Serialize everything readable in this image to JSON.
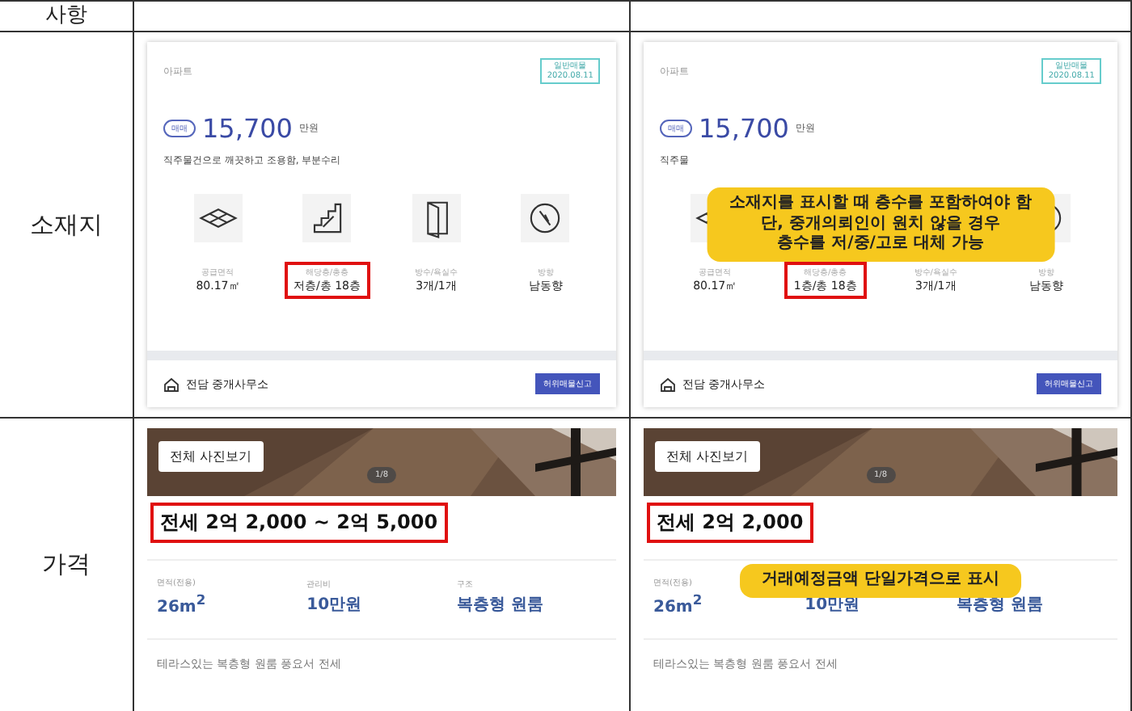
{
  "header": {
    "label": "사항"
  },
  "location": {
    "label": "소재지",
    "panels": [
      {
        "type": "아파트",
        "badge": [
          "일반매물",
          "2020.08.11"
        ],
        "deal": "매매",
        "price": "15,700",
        "unit": "만원",
        "desc": "직주물건으로 깨끗하고 조용함, 부분수리",
        "features": [
          {
            "kind": "area",
            "label": "공급면적",
            "value": "80.17㎡",
            "highlighted": false
          },
          {
            "kind": "stairs",
            "label": "해당층/총층",
            "value": "저층/총 18층",
            "highlighted": true
          },
          {
            "kind": "door",
            "label": "방수/욕실수",
            "value": "3개/1개",
            "highlighted": false
          },
          {
            "kind": "compass",
            "label": "방향",
            "value": "남동향",
            "highlighted": false
          }
        ],
        "agency": "전담 중개사무소",
        "report": "허위매물신고"
      },
      {
        "type": "아파트",
        "badge": [
          "일반매물",
          "2020.08.11"
        ],
        "deal": "매매",
        "price": "15,700",
        "unit": "만원",
        "desc": "직주물",
        "features": [
          {
            "kind": "area",
            "label": "공급면적",
            "value": "80.17㎡",
            "highlighted": false
          },
          {
            "label": "해당층/총층",
            "value": "1층/총 18층",
            "highlighted": true
          },
          {
            "label": "방수/욕실수",
            "value": "3개/1개",
            "highlighted": false
          },
          {
            "kind": "compass",
            "label": "방향",
            "value": "남동향",
            "highlighted": false
          }
        ],
        "agency": "전담 중개사무소",
        "report": "허위매물신고",
        "callout": [
          "소재지를 표시할 때 층수를 포함하여야 함",
          "단, 중개의뢰인이 원치 않을 경우",
          "층수를 저/중/고로 대체 가능"
        ]
      }
    ]
  },
  "price": {
    "label": "가격",
    "panels": [
      {
        "photo_button": "전체 사진보기",
        "counter": "1/8",
        "price": "전세 2억 2,000 ~ 2억 5,000",
        "price_highlighted": true,
        "specs": [
          {
            "label": "면적(전용)",
            "value": "26m$^{2}$"
          },
          {
            "label": "관리비",
            "value": "10만원"
          },
          {
            "label": "구조",
            "value": "복층형 원룸"
          }
        ],
        "desc": "테라스있는 복층형 원룸 풍요서 전세"
      },
      {
        "photo_button": "전체 사진보기",
        "counter": "1/8",
        "price": "전세 2억 2,000",
        "price_highlighted": true,
        "specs": [
          {
            "label": "면적(전용)",
            "value": "26m$^{2}$"
          },
          {
            "value": "10만원"
          },
          {
            "value": "복층형 원룸"
          }
        ],
        "desc": "테라스있는 복층형 원룸 풍요서 전세",
        "callout": [
          "거래예정금액 단일가격으로 표시"
        ]
      }
    ]
  }
}
